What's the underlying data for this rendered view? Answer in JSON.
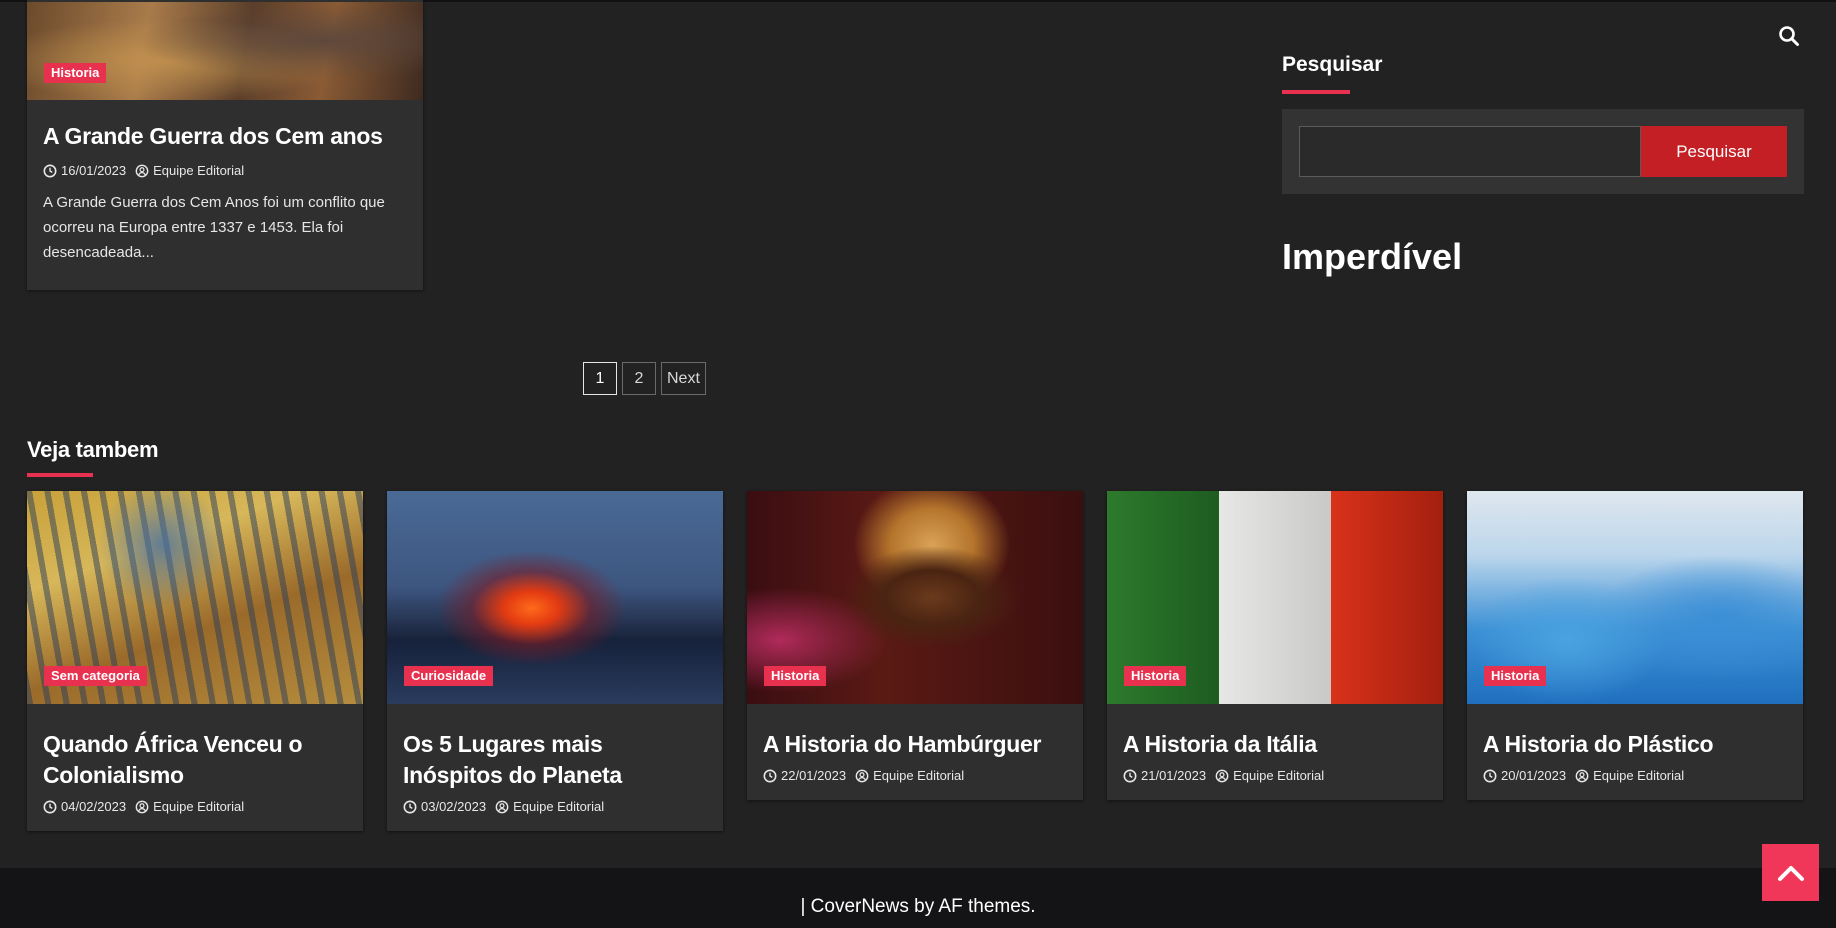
{
  "main_post": {
    "category": "Historia",
    "title": "A Grande Guerra dos Cem anos",
    "date": "16/01/2023",
    "author": "Equipe Editorial",
    "excerpt": "A Grande Guerra dos Cem Anos foi um conflito que ocorreu na Europa entre 1337 e 1453. Ela foi desencadeada..."
  },
  "pagination": {
    "pages": [
      "1",
      "2"
    ],
    "current": "1",
    "next_label": "Next"
  },
  "sidebar": {
    "search_title": "Pesquisar",
    "search_placeholder": "",
    "search_button": "Pesquisar",
    "section_heading": "Imperdível"
  },
  "related": {
    "title": "Veja tambem",
    "items": [
      {
        "category": "Sem categoria",
        "title": "Quando África Venceu o Colonialismo",
        "date": "04/02/2023",
        "author": "Equipe Editorial"
      },
      {
        "category": "Curiosidade",
        "title": "Os 5 Lugares mais Inóspitos do Planeta",
        "date": "03/02/2023",
        "author": "Equipe Editorial"
      },
      {
        "category": "Historia",
        "title": "A Historia do Hambúrguer",
        "date": "22/01/2023",
        "author": "Equipe Editorial"
      },
      {
        "category": "Historia",
        "title": "A Historia da Itália",
        "date": "21/01/2023",
        "author": "Equipe Editorial"
      },
      {
        "category": "Historia",
        "title": "A Historia do Plástico",
        "date": "20/01/2023",
        "author": "Equipe Editorial"
      }
    ]
  },
  "footer": {
    "text": "| CoverNews by AF themes."
  },
  "colors": {
    "accent": "#e8314f",
    "button": "#c31f25",
    "background": "#222222",
    "card": "#2f2f2f"
  }
}
